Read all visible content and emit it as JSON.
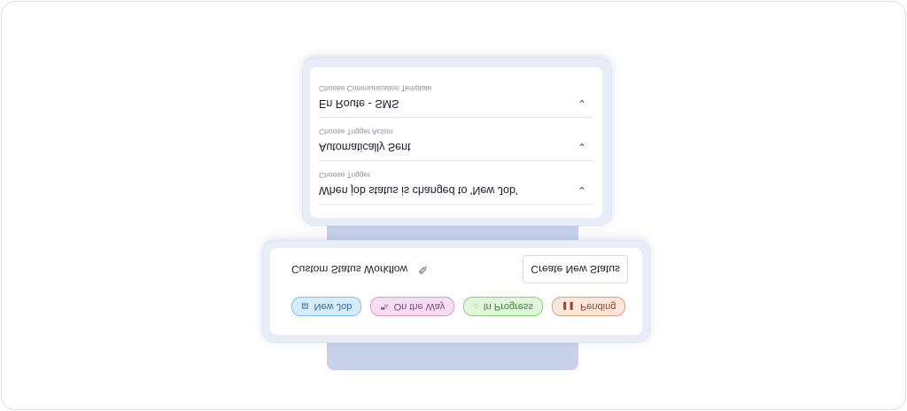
{
  "status_card": {
    "chips": [
      {
        "label": "New Job",
        "icon": "calendar-icon"
      },
      {
        "label": "On the Way",
        "icon": "car-icon"
      },
      {
        "label": "In Progress",
        "icon": "spinner-icon"
      },
      {
        "label": "Pending",
        "icon": "pause-icon"
      }
    ],
    "workflow_title": "Custom Status Workflow",
    "create_button": "Create New Status"
  },
  "automation_card": {
    "items": [
      {
        "title": "When job status is changed to 'New Job'",
        "subtitle": "Choose Trigger"
      },
      {
        "title": "Automatically Sent",
        "subtitle": "Choose Trigger Action"
      },
      {
        "title": "En Route - SMS",
        "subtitle": "Choose Communication Template"
      }
    ]
  },
  "colors": {
    "background_bar": "#c8d2ea",
    "chip_new": "#d7ecfb",
    "chip_on_the_way": "#f4dff2",
    "chip_in_progress": "#e1f4dc",
    "chip_pending": "#fbe6dc"
  }
}
